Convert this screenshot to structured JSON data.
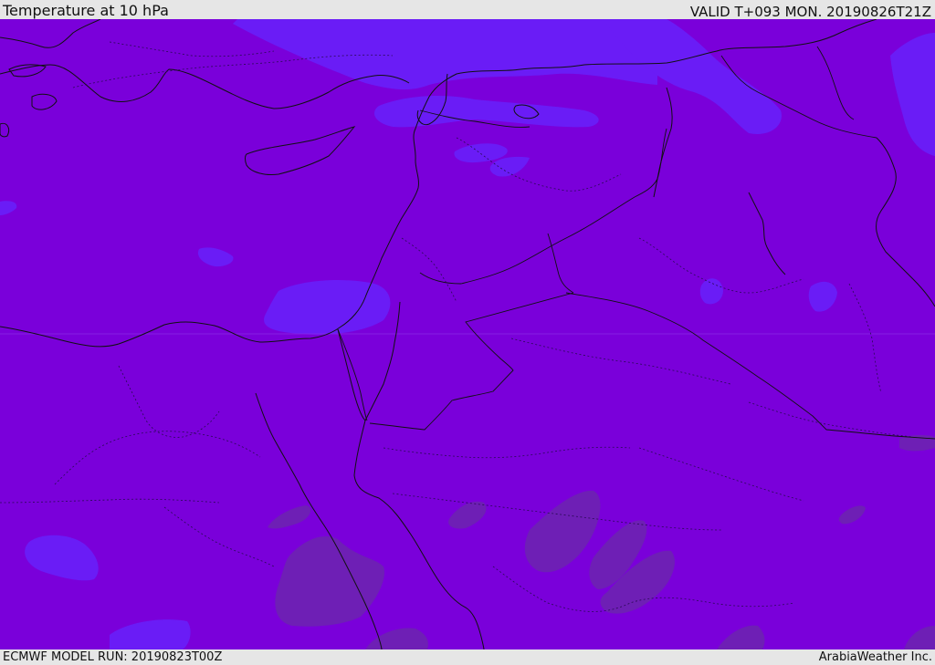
{
  "header": {
    "title": "Temperature at 10 hPa",
    "valid": "VALID T+093 MON. 20190826T21Z"
  },
  "footer": {
    "model_run": "ECMWF MODEL RUN: 20190823T00Z",
    "credit": "ArabiaWeather Inc."
  },
  "colors": {
    "base_field": "#7a00da",
    "warmer_field": "#6a1cf6",
    "cooler_field": "#6e1fb5",
    "coastline": "#111111",
    "header_background": "#e6e6e6"
  }
}
